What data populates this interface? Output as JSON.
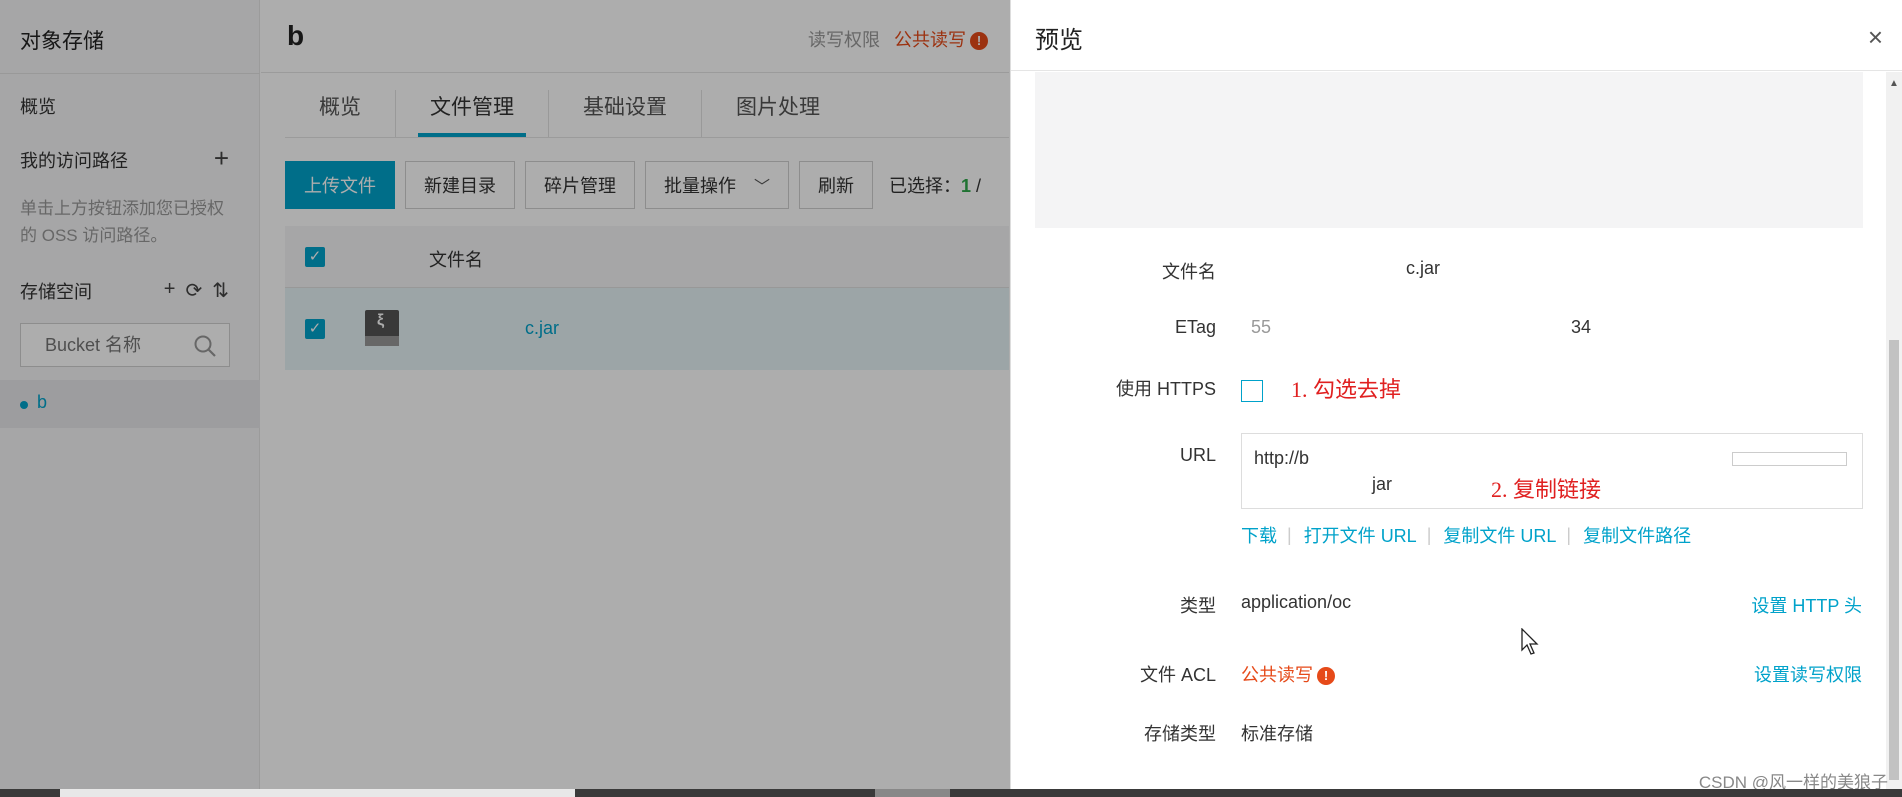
{
  "sidebar": {
    "title": "对象存储",
    "overview": "概览",
    "access_paths": "我的访问路径",
    "add_icon": "plus-icon",
    "hint": "单击上方按钮添加您已授权的 OSS 访问路径。",
    "storage": "存储空间",
    "search_placeholder": "Bucket 名称",
    "bucket": "b"
  },
  "header": {
    "bucket_title": "b",
    "perm_label": "读写权限",
    "perm_value": "公共读写",
    "warn_glyph": "!"
  },
  "tabs": [
    "概览",
    "文件管理",
    "基础设置",
    "图片处理"
  ],
  "toolbar": {
    "upload": "上传文件",
    "new_dir": "新建目录",
    "fragments": "碎片管理",
    "batch": "批量操作",
    "refresh": "刷新",
    "selected_label": "已选择：",
    "selected_count": "1",
    "selected_sep": "/"
  },
  "table": {
    "header_name": "文件名",
    "row_name": "c.jar"
  },
  "drawer": {
    "title": "预览",
    "close": "×",
    "filename_label": "文件名",
    "filename_value": "c.jar",
    "etag_label": "ETag",
    "etag_start": "55",
    "etag_end": "34",
    "https_label": "使用 HTTPS",
    "annot1": "1. 勾选去掉",
    "url_label": "URL",
    "url_line1": "http://b",
    "url_line2": "jar",
    "annot2": "2. 复制链接",
    "links": [
      "下载",
      "打开文件 URL",
      "复制文件 URL",
      "复制文件路径"
    ],
    "type_label": "类型",
    "type_value": "application/oc",
    "set_http_header": "设置 HTTP 头",
    "acl_label": "文件 ACL",
    "acl_value": "公共读写",
    "set_acl": "设置读写权限",
    "storage_class_label": "存储类型",
    "storage_class_value": "标准存储",
    "watermark": "CSDN @风一样的美狼子"
  },
  "colors": {
    "accent": "#00a2ca",
    "warning": "#e64a19",
    "annotation": "#e02020"
  }
}
